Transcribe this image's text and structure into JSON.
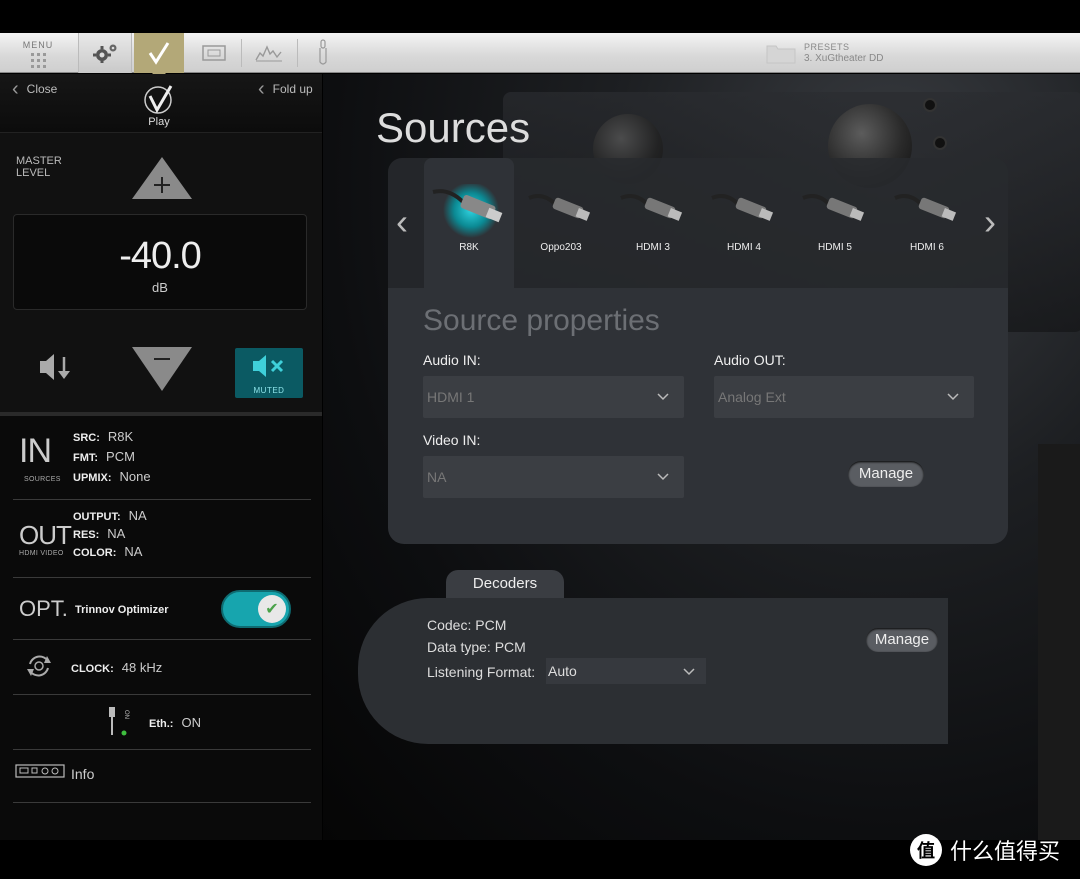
{
  "toolbar": {
    "menu_label": "MENU",
    "presets_label": "PRESETS",
    "preset_value": "3. XuGtheater DD"
  },
  "left_panel": {
    "close_label": "Close",
    "fold_label": "Fold up",
    "play_label": "Play",
    "master_level_label": "MASTER\nLEVEL",
    "volume_value": "-40.0",
    "volume_unit": "dB",
    "muted_label": "MUTED",
    "in": {
      "big": "IN",
      "small": "SOURCES",
      "src_key": "SRC:",
      "src_val": "R8K",
      "fmt_key": "FMT:",
      "fmt_val": "PCM",
      "upmix_key": "UPMIX:",
      "upmix_val": "None"
    },
    "out": {
      "big": "OUT",
      "small": "HDMI VIDEO",
      "output_key": "OUTPUT:",
      "output_val": "NA",
      "res_key": "RES:",
      "res_val": "NA",
      "color_key": "COLOR:",
      "color_val": "NA"
    },
    "opt": {
      "big": "OPT.",
      "name": "Trinnov Optimizer",
      "enabled": true
    },
    "clock": {
      "key": "CLOCK:",
      "val": "48 kHz"
    },
    "eth": {
      "key": "Eth.:",
      "val": "ON",
      "icon_label": "ON"
    },
    "info_label": "Info"
  },
  "main": {
    "title": "Sources",
    "sources": [
      {
        "name": "R8K",
        "selected": true
      },
      {
        "name": "Oppo203",
        "selected": false
      },
      {
        "name": "HDMI 3",
        "selected": false
      },
      {
        "name": "HDMI 4",
        "selected": false
      },
      {
        "name": "HDMI 5",
        "selected": false
      },
      {
        "name": "HDMI 6",
        "selected": false
      }
    ],
    "props_title": "Source properties",
    "audio_in_label": "Audio IN:",
    "audio_in_value": "HDMI 1",
    "audio_out_label": "Audio OUT:",
    "audio_out_value": "Analog Ext",
    "video_in_label": "Video IN:",
    "video_in_value": "NA",
    "manage_label": "Manage",
    "decoders_tab": "Decoders",
    "codec": "Codec: PCM",
    "data_type": "Data type: PCM",
    "listening_format_label": "Listening Format:",
    "listening_format_value": "Auto",
    "decoders_manage_label": "Manage"
  },
  "watermark": {
    "badge": "值",
    "text": "什么值得买"
  },
  "colors": {
    "accent": "#17a5ae",
    "muted_bg": "#0b5a63",
    "play_tab": "#b3a878"
  }
}
